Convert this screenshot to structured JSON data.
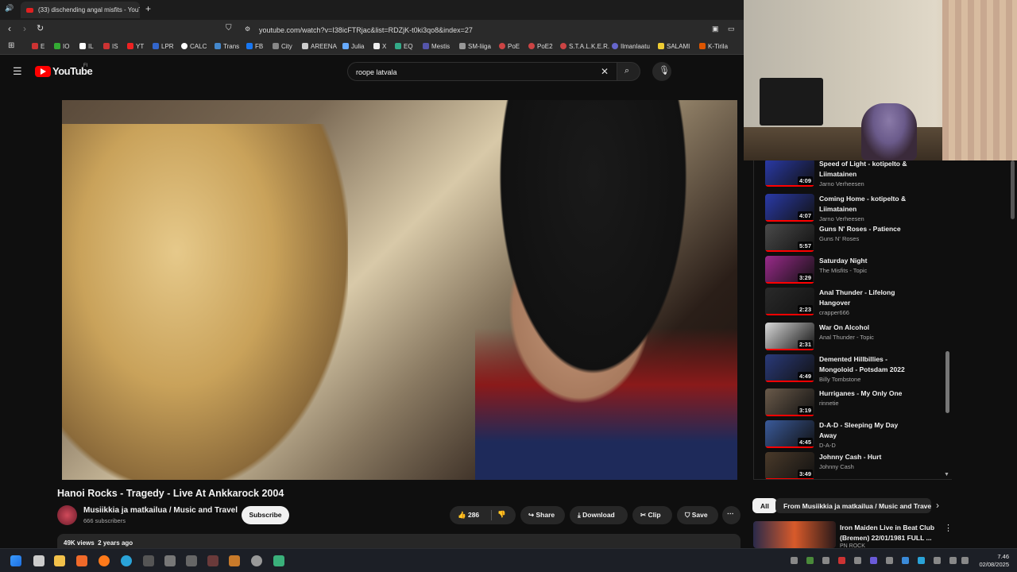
{
  "browser": {
    "tab_title": "(33) dischending angal misfits - YouT",
    "url": "youtube.com/watch?v=I38icFTRjac&list=RDZjK-t0ki3qo8&index=27",
    "bookmarks": [
      "E",
      "IO",
      "IL",
      "IS",
      "YT",
      "LPR",
      "CALC",
      "Trans",
      "FB",
      "City",
      "AREENA",
      "Julia",
      "X",
      "EQ",
      "Mestis",
      "SM-liiga",
      "PoE",
      "PoE2",
      "S.T.A.L.K.E.R.",
      "Ilmanlaatu",
      "SALAMI",
      "K-Tirila"
    ]
  },
  "youtube": {
    "logo": "YouTube",
    "region": "FI",
    "search_value": "roope latvala"
  },
  "video": {
    "title": "Hanoi Rocks - Tragedy - Live At Ankkarock 2004",
    "channel": "Musiikkia ja matkailua / Music and Travel",
    "subscribers": "666 subscribers",
    "subscribe_label": "Subscribe",
    "likes": "286",
    "share_label": "Share",
    "download_label": "Download",
    "clip_label": "Clip",
    "save_label": "Save",
    "views": "49K views",
    "age": "2 years ago"
  },
  "playlist": [
    {
      "title": "Speed of Light - kotipelto & Liimatainen",
      "channel": "Jarno Verheesen",
      "duration": "4:09",
      "color": "#2a3aa8"
    },
    {
      "title": "Coming Home - kotipelto & Liimatainen",
      "channel": "Jarno Verheesen",
      "duration": "4:07",
      "color": "#2a3aa8"
    },
    {
      "title": "Guns N' Roses - Patience",
      "channel": "Guns N' Roses",
      "duration": "5:57",
      "color": "#4a4a4a"
    },
    {
      "title": "Saturday Night",
      "channel": "The Misfits - Topic",
      "duration": "3:29",
      "color": "#9a2a8a"
    },
    {
      "title": "Anal Thunder - Lifelong Hangover",
      "channel": "crapper666",
      "duration": "2:23",
      "color": "#2a2a2a"
    },
    {
      "title": "War On Alcohol",
      "channel": "Anal Thunder - Topic",
      "duration": "2:31",
      "color": "#d8d8d8"
    },
    {
      "title": "Demented Hillbillies - Mongoloid - Potsdam 2022",
      "channel": "Billy Tombstone",
      "duration": "4:49",
      "color": "#2a3a7a"
    },
    {
      "title": "Hurriganes - My Only One",
      "channel": "rinnetie",
      "duration": "3:19",
      "color": "#6a5a4a"
    },
    {
      "title": "D-A-D - Sleeping My Day Away",
      "channel": "D-A-D",
      "duration": "4:45",
      "color": "#3a5a9a"
    },
    {
      "title": "Johnny Cash - Hurt",
      "channel": "Johnny Cash",
      "duration": "3:49",
      "color": "#4a3a2a"
    }
  ],
  "chips": {
    "all": "All",
    "from_channel": "From Musiikkia ja matkailua / Music and Trave"
  },
  "recommendation": {
    "title": "Iron Maiden Live in Beat Club (Bremen) 22/01/1981 FULL ...",
    "channel": "PN ROCK"
  },
  "taskbar": {
    "time": "7.46",
    "date": "02/08/2025"
  }
}
